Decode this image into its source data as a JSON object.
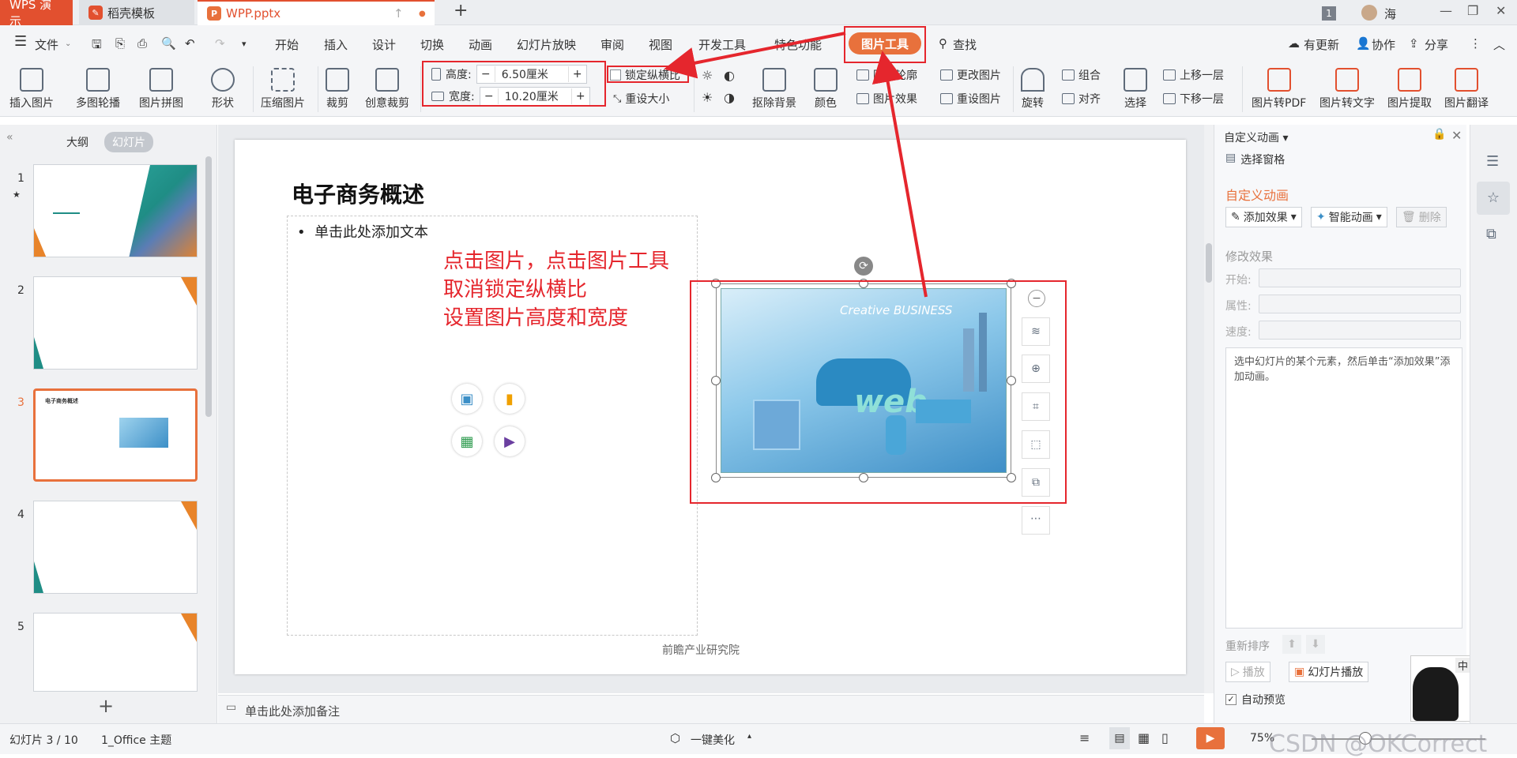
{
  "titlebar": {
    "tabs": [
      {
        "label": "WPS 演示"
      },
      {
        "label": "稻壳模板"
      },
      {
        "label": "WPP.pptx"
      }
    ],
    "badge": "1",
    "user": "海"
  },
  "menubar": {
    "file": "文件",
    "items": [
      "开始",
      "插入",
      "设计",
      "切换",
      "动画",
      "幻灯片放映",
      "审阅",
      "视图",
      "开发工具",
      "特色功能"
    ],
    "active_tool": "图片工具",
    "search": "查找",
    "update": "有更新",
    "collab": "协作",
    "share": "分享"
  },
  "ribbon": {
    "insert_picture": "插入图片",
    "carousel": "多图轮播",
    "collage": "图片拼图",
    "shape": "形状",
    "compress": "压缩图片",
    "crop": "裁剪",
    "creative_crop": "创意裁剪",
    "height_label": "高度:",
    "height_value": "6.50厘米",
    "width_label": "宽度:",
    "width_value": "10.20厘米",
    "minus": "−",
    "plus": "+",
    "lock_ratio": "锁定纵横比",
    "reset_size": "重设大小",
    "remove_bg": "抠除背景",
    "color": "颜色",
    "outline": "图片轮廓",
    "effect": "图片效果",
    "change_pic": "更改图片",
    "reset_pic": "重设图片",
    "rotate": "旋转",
    "group": "组合",
    "align": "对齐",
    "select": "选择",
    "bring_forward": "上移一层",
    "send_backward": "下移一层",
    "to_pdf": "图片转PDF",
    "to_text": "图片转文字",
    "extract": "图片提取",
    "translate": "图片翻译"
  },
  "leftpanel": {
    "outline_tab": "大纲",
    "slides_tab": "幻灯片",
    "slides": [
      {
        "num": "1",
        "mark": "★"
      },
      {
        "num": "2"
      },
      {
        "num": "3",
        "title": "电子商务概述"
      },
      {
        "num": "4"
      },
      {
        "num": "5"
      }
    ],
    "add": "+"
  },
  "slide": {
    "title": "电子商务概述",
    "bullet": "单击此处添加文本",
    "annotation": [
      "点击图片，点击图片工具",
      "取消锁定纵横比",
      "设置图片高度和宽度"
    ],
    "picture_text": "Creative BUSINESS",
    "picture_word": "web",
    "footer": "前瞻产业研究院"
  },
  "rightpanel": {
    "header": "自定义动画",
    "select_pane": "选择窗格",
    "section_title": "自定义动画",
    "add_effect": "添加效果",
    "smart_anim": "智能动画",
    "delete": "删除",
    "modify": "修改效果",
    "start": "开始:",
    "property": "属性:",
    "speed": "速度:",
    "hint": "选中幻灯片的某个元素，然后单击“添加效果”添加动画。",
    "reorder": "重新排序",
    "play": "播放",
    "slideshow": "幻灯片播放",
    "autopreview": "自动预览"
  },
  "notes": {
    "placeholder": "单击此处添加备注"
  },
  "status": {
    "slide_info": "幻灯片 3 / 10",
    "theme": "1_Office 主题",
    "beautify": "一键美化",
    "zoom": "75%",
    "watermark": "CSDN @OKCorrect"
  },
  "sidebar_ime": "中",
  "colors": {
    "accent": "#e8713c",
    "wps_red": "#e2502f",
    "annotation_red": "#e5262d"
  }
}
